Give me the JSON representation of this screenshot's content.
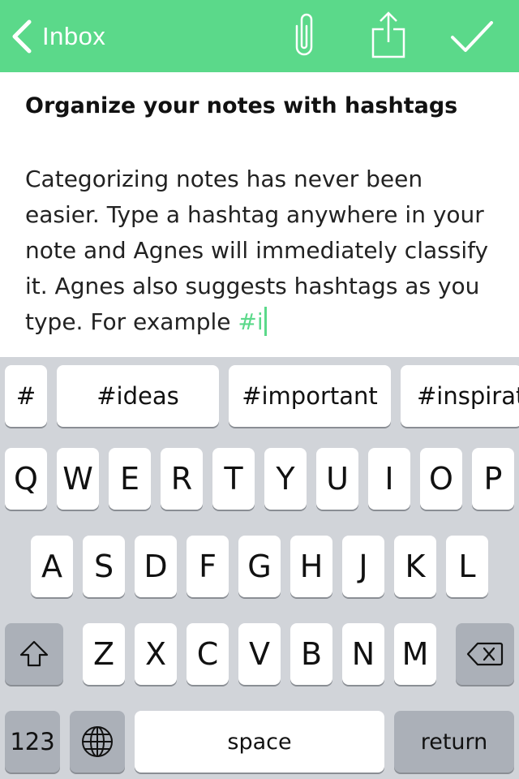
{
  "navbar": {
    "back_label": "Inbox",
    "icons": [
      "chevron-left-icon",
      "paperclip-icon",
      "share-icon",
      "checkmark-icon"
    ],
    "color": "#5bd98a"
  },
  "note": {
    "title": "Organize your notes with hashtags",
    "body_text": "Categorizing notes has never been easier. Type a hashtag anywhere in your note and Agnes will immediately classify it. Agnes also suggests hashtags as you type. For example ",
    "typed_hashtag": "#i"
  },
  "keyboard": {
    "suggestion_bar": {
      "hash_key": "#",
      "suggestions": [
        "#ideas",
        "#important",
        "#inspiration"
      ]
    },
    "rows": [
      [
        "Q",
        "W",
        "E",
        "R",
        "T",
        "Y",
        "U",
        "I",
        "O",
        "P"
      ],
      [
        "A",
        "S",
        "D",
        "F",
        "G",
        "H",
        "J",
        "K",
        "L"
      ],
      [
        "Z",
        "X",
        "C",
        "V",
        "B",
        "N",
        "M"
      ]
    ],
    "shift_icon": "shift-icon",
    "delete_icon": "backspace-icon",
    "numbers_label": "123",
    "globe_icon": "globe-icon",
    "space_label": "space",
    "return_label": "return"
  }
}
